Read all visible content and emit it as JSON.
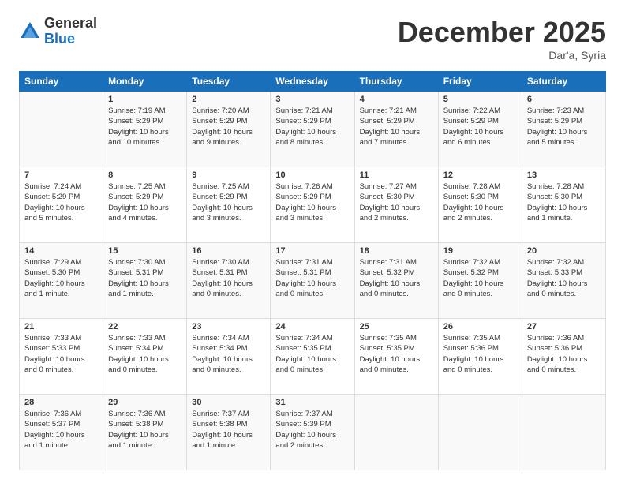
{
  "logo": {
    "general": "General",
    "blue": "Blue"
  },
  "title": "December 2025",
  "location": "Dar'a, Syria",
  "days_of_week": [
    "Sunday",
    "Monday",
    "Tuesday",
    "Wednesday",
    "Thursday",
    "Friday",
    "Saturday"
  ],
  "weeks": [
    [
      {
        "num": "",
        "info": ""
      },
      {
        "num": "1",
        "info": "Sunrise: 7:19 AM\nSunset: 5:29 PM\nDaylight: 10 hours\nand 10 minutes."
      },
      {
        "num": "2",
        "info": "Sunrise: 7:20 AM\nSunset: 5:29 PM\nDaylight: 10 hours\nand 9 minutes."
      },
      {
        "num": "3",
        "info": "Sunrise: 7:21 AM\nSunset: 5:29 PM\nDaylight: 10 hours\nand 8 minutes."
      },
      {
        "num": "4",
        "info": "Sunrise: 7:21 AM\nSunset: 5:29 PM\nDaylight: 10 hours\nand 7 minutes."
      },
      {
        "num": "5",
        "info": "Sunrise: 7:22 AM\nSunset: 5:29 PM\nDaylight: 10 hours\nand 6 minutes."
      },
      {
        "num": "6",
        "info": "Sunrise: 7:23 AM\nSunset: 5:29 PM\nDaylight: 10 hours\nand 5 minutes."
      }
    ],
    [
      {
        "num": "7",
        "info": "Sunrise: 7:24 AM\nSunset: 5:29 PM\nDaylight: 10 hours\nand 5 minutes."
      },
      {
        "num": "8",
        "info": "Sunrise: 7:25 AM\nSunset: 5:29 PM\nDaylight: 10 hours\nand 4 minutes."
      },
      {
        "num": "9",
        "info": "Sunrise: 7:25 AM\nSunset: 5:29 PM\nDaylight: 10 hours\nand 3 minutes."
      },
      {
        "num": "10",
        "info": "Sunrise: 7:26 AM\nSunset: 5:29 PM\nDaylight: 10 hours\nand 3 minutes."
      },
      {
        "num": "11",
        "info": "Sunrise: 7:27 AM\nSunset: 5:30 PM\nDaylight: 10 hours\nand 2 minutes."
      },
      {
        "num": "12",
        "info": "Sunrise: 7:28 AM\nSunset: 5:30 PM\nDaylight: 10 hours\nand 2 minutes."
      },
      {
        "num": "13",
        "info": "Sunrise: 7:28 AM\nSunset: 5:30 PM\nDaylight: 10 hours\nand 1 minute."
      }
    ],
    [
      {
        "num": "14",
        "info": "Sunrise: 7:29 AM\nSunset: 5:30 PM\nDaylight: 10 hours\nand 1 minute."
      },
      {
        "num": "15",
        "info": "Sunrise: 7:30 AM\nSunset: 5:31 PM\nDaylight: 10 hours\nand 1 minute."
      },
      {
        "num": "16",
        "info": "Sunrise: 7:30 AM\nSunset: 5:31 PM\nDaylight: 10 hours\nand 0 minutes."
      },
      {
        "num": "17",
        "info": "Sunrise: 7:31 AM\nSunset: 5:31 PM\nDaylight: 10 hours\nand 0 minutes."
      },
      {
        "num": "18",
        "info": "Sunrise: 7:31 AM\nSunset: 5:32 PM\nDaylight: 10 hours\nand 0 minutes."
      },
      {
        "num": "19",
        "info": "Sunrise: 7:32 AM\nSunset: 5:32 PM\nDaylight: 10 hours\nand 0 minutes."
      },
      {
        "num": "20",
        "info": "Sunrise: 7:32 AM\nSunset: 5:33 PM\nDaylight: 10 hours\nand 0 minutes."
      }
    ],
    [
      {
        "num": "21",
        "info": "Sunrise: 7:33 AM\nSunset: 5:33 PM\nDaylight: 10 hours\nand 0 minutes."
      },
      {
        "num": "22",
        "info": "Sunrise: 7:33 AM\nSunset: 5:34 PM\nDaylight: 10 hours\nand 0 minutes."
      },
      {
        "num": "23",
        "info": "Sunrise: 7:34 AM\nSunset: 5:34 PM\nDaylight: 10 hours\nand 0 minutes."
      },
      {
        "num": "24",
        "info": "Sunrise: 7:34 AM\nSunset: 5:35 PM\nDaylight: 10 hours\nand 0 minutes."
      },
      {
        "num": "25",
        "info": "Sunrise: 7:35 AM\nSunset: 5:35 PM\nDaylight: 10 hours\nand 0 minutes."
      },
      {
        "num": "26",
        "info": "Sunrise: 7:35 AM\nSunset: 5:36 PM\nDaylight: 10 hours\nand 0 minutes."
      },
      {
        "num": "27",
        "info": "Sunrise: 7:36 AM\nSunset: 5:36 PM\nDaylight: 10 hours\nand 0 minutes."
      }
    ],
    [
      {
        "num": "28",
        "info": "Sunrise: 7:36 AM\nSunset: 5:37 PM\nDaylight: 10 hours\nand 1 minute."
      },
      {
        "num": "29",
        "info": "Sunrise: 7:36 AM\nSunset: 5:38 PM\nDaylight: 10 hours\nand 1 minute."
      },
      {
        "num": "30",
        "info": "Sunrise: 7:37 AM\nSunset: 5:38 PM\nDaylight: 10 hours\nand 1 minute."
      },
      {
        "num": "31",
        "info": "Sunrise: 7:37 AM\nSunset: 5:39 PM\nDaylight: 10 hours\nand 2 minutes."
      },
      {
        "num": "",
        "info": ""
      },
      {
        "num": "",
        "info": ""
      },
      {
        "num": "",
        "info": ""
      }
    ]
  ]
}
